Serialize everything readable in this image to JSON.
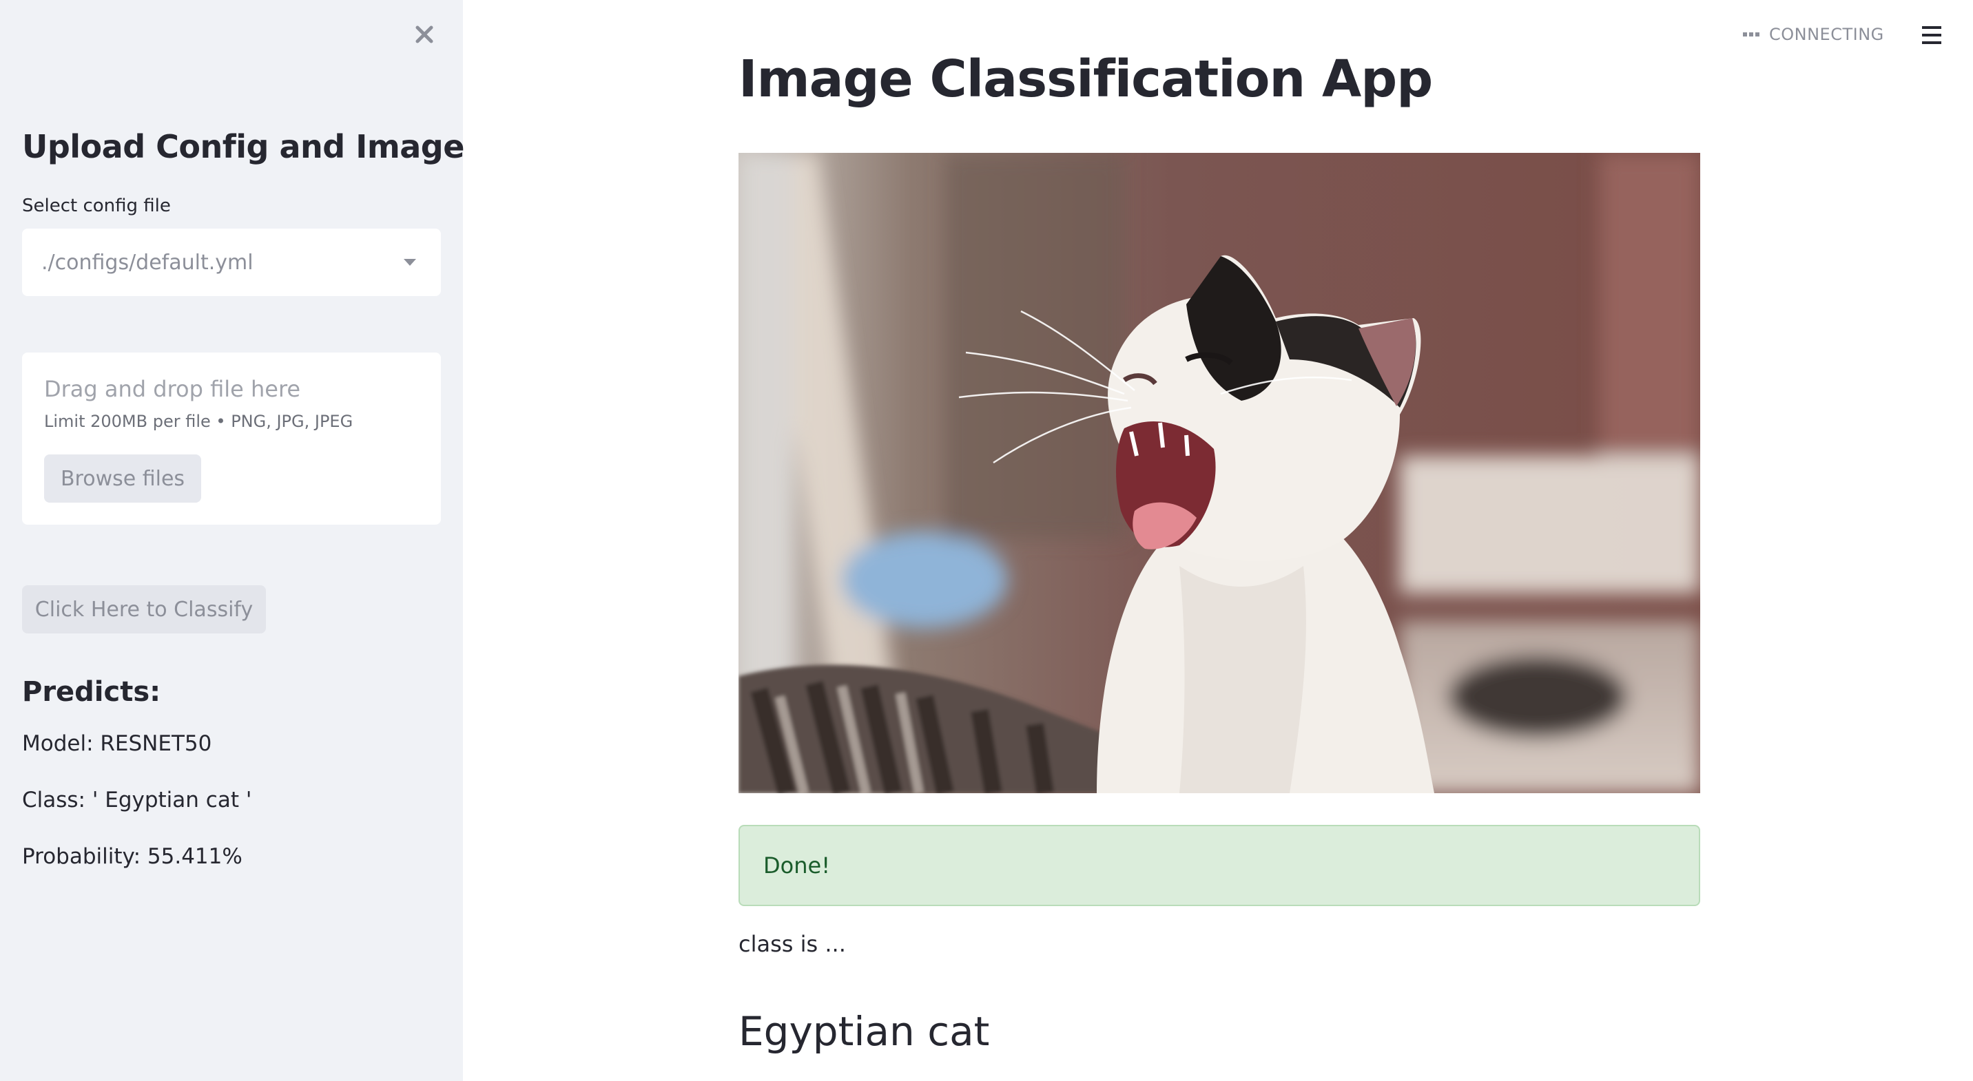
{
  "sidebar": {
    "title": "Upload Config and Image",
    "close_icon": "close-icon",
    "config_select": {
      "label": "Select config file",
      "value": "./configs/default.yml"
    },
    "uploader": {
      "drag_text": "Drag and drop file here",
      "limit_text": "Limit 200MB per file • PNG, JPG, JPEG",
      "browse_label": "Browse files"
    },
    "classify_label": "Click Here to Classify",
    "predicts": {
      "heading": "Predicts:",
      "model": "Model: RESNET50",
      "class": "Class: ' Egyptian cat '",
      "probability": "Probability: 55.411%"
    }
  },
  "header": {
    "status": "CONNECTING",
    "menu_icon": "hamburger-menu-icon"
  },
  "main": {
    "title": "Image Classification App",
    "image_subject": "yawning white and black cat",
    "success_message": "Done!",
    "class_prefix": "class is ...",
    "result_class": "Egyptian cat"
  },
  "colors": {
    "sidebar_bg": "#f0f2f6",
    "text": "#262730",
    "success_bg": "#dbeddb",
    "success_text": "#1a5c2b"
  }
}
